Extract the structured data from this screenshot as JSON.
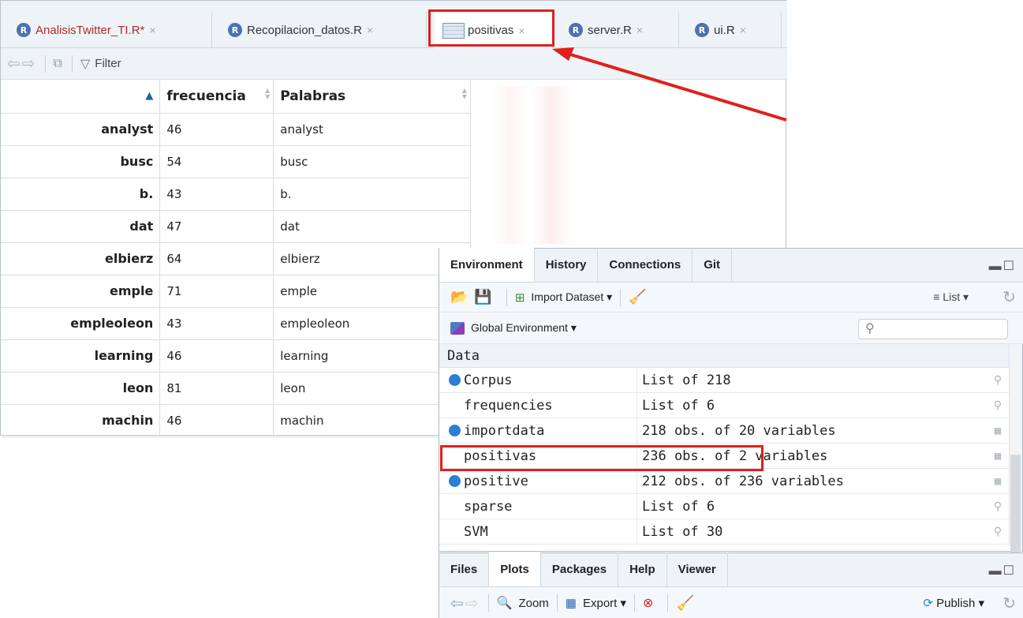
{
  "editor": {
    "tabs": [
      {
        "label": "AnalisisTwitter_TI.R*",
        "kind": "r",
        "modified": true
      },
      {
        "label": "Recopilacion_datos.R",
        "kind": "r"
      },
      {
        "label": "positivas",
        "kind": "table"
      },
      {
        "label": "server.R",
        "kind": "r"
      },
      {
        "label": "ui.R",
        "kind": "r"
      }
    ],
    "close_glyph": "×",
    "toolbar": {
      "filter_label": "Filter"
    },
    "table": {
      "columns": [
        "",
        "frecuencia",
        "Palabras"
      ],
      "rows": [
        {
          "name": "analyst",
          "frecuencia": "46",
          "palabras": "analyst"
        },
        {
          "name": "busc",
          "frecuencia": "54",
          "palabras": "busc"
        },
        {
          "name": "b.",
          "frecuencia": "43",
          "palabras": "b."
        },
        {
          "name": "dat",
          "frecuencia": "47",
          "palabras": "dat"
        },
        {
          "name": "elbierz",
          "frecuencia": "64",
          "palabras": "elbierz"
        },
        {
          "name": "emple",
          "frecuencia": "71",
          "palabras": "emple"
        },
        {
          "name": "empleoleon",
          "frecuencia": "43",
          "palabras": "empleoleon"
        },
        {
          "name": "learning",
          "frecuencia": "46",
          "palabras": "learning"
        },
        {
          "name": "leon",
          "frecuencia": "81",
          "palabras": "leon"
        },
        {
          "name": "machin",
          "frecuencia": "46",
          "palabras": "machin"
        }
      ]
    }
  },
  "env": {
    "tabs": [
      "Environment",
      "History",
      "Connections",
      "Git"
    ],
    "import_label": "Import Dataset ▾",
    "list_label": "List ▾",
    "scope_label": "Global Environment ▾",
    "search_glyph": "⚲",
    "section": "Data",
    "rows": [
      {
        "name": "Corpus",
        "value": "List of 218",
        "dot": true,
        "action": "search"
      },
      {
        "name": "frequencies",
        "value": "List of 6",
        "dot": false,
        "action": "search"
      },
      {
        "name": "importdata",
        "value": "218 obs. of 20 variables",
        "dot": true,
        "action": "table"
      },
      {
        "name": "positivas",
        "value": "236 obs. of 2 variables",
        "dot": false,
        "action": "table"
      },
      {
        "name": "positive",
        "value": "212 obs. of 236 variables",
        "dot": true,
        "action": "table"
      },
      {
        "name": "sparse",
        "value": "List of 6",
        "dot": false,
        "action": "search"
      },
      {
        "name": "SVM",
        "value": "List of 30",
        "dot": false,
        "action": "search"
      }
    ]
  },
  "files": {
    "tabs": [
      "Files",
      "Plots",
      "Packages",
      "Help",
      "Viewer"
    ],
    "zoom_label": "Zoom",
    "export_label": "Export ▾",
    "publish_label": "Publish ▾"
  },
  "colors": {
    "highlight": "#e0201c",
    "accent": "#2c7fd4"
  }
}
